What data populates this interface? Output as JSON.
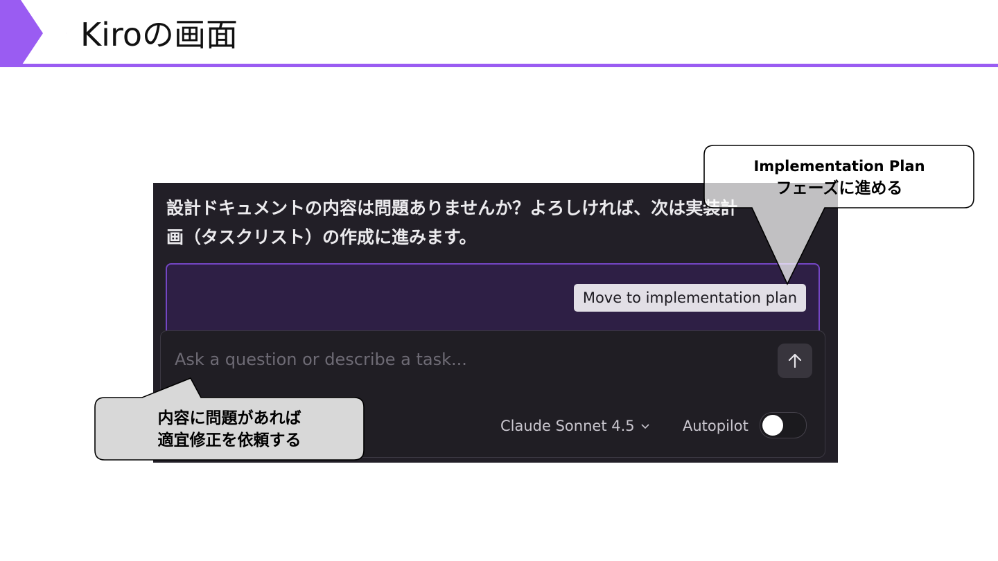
{
  "slide": {
    "title": "Kiroの画面",
    "accent_color": "#9a5cf2"
  },
  "panel": {
    "message_line1": "設計ドキュメントの内容は問題ありませんか？よろしければ、次は実装計",
    "message_line2": "画（タスクリスト）の作成に進みます。",
    "move_button_label": "Move to implementation plan",
    "chat": {
      "placeholder": "Ask a question or describe a task...",
      "value": "",
      "send_icon": "arrow-up-icon",
      "model": "Claude Sonnet 4.5",
      "model_icon": "chevron-down-icon",
      "autopilot_label": "Autopilot",
      "autopilot_on": false
    }
  },
  "callouts": {
    "top_line1": "Implementation Plan",
    "top_line2": "フェーズに進める",
    "bottom_line1": "内容に問題があれば",
    "bottom_line2": "適宜修正を依頼する"
  }
}
